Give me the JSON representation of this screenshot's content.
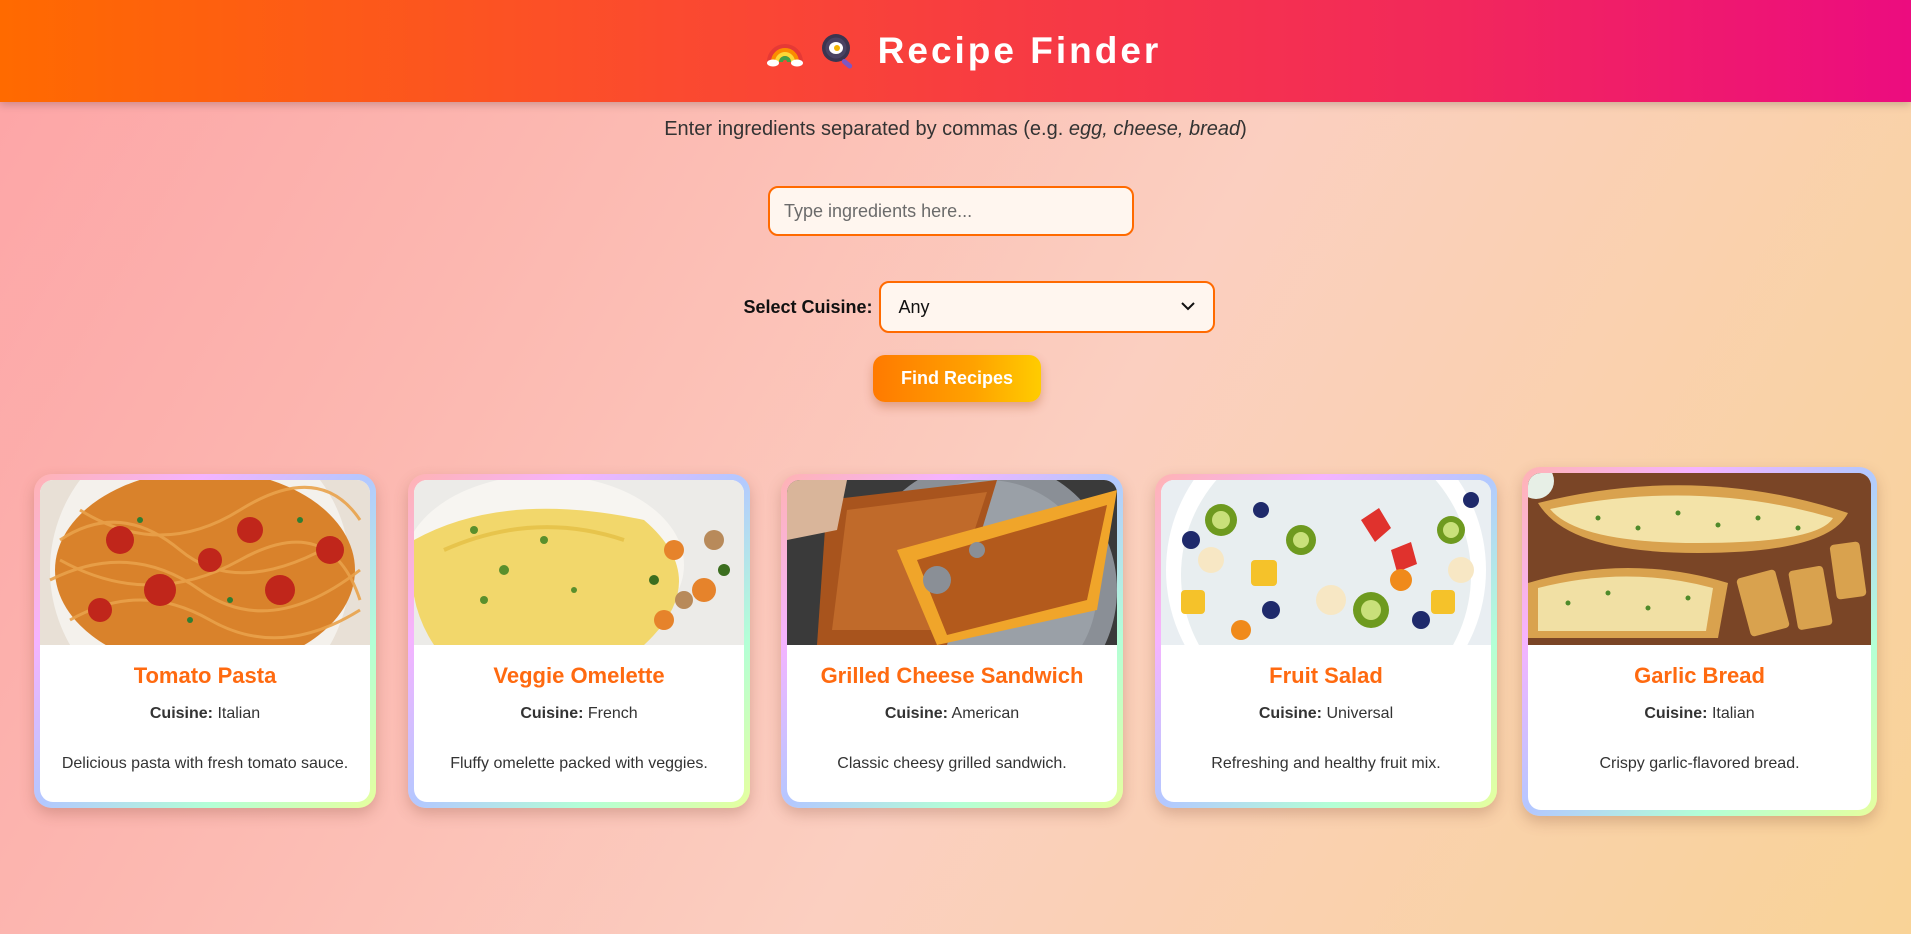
{
  "header": {
    "title": "Recipe Finder",
    "icons": [
      "rainbow-icon",
      "frying-pan-egg-icon"
    ]
  },
  "instructions": {
    "prefix": "Enter ingredients separated by commas (e.g. ",
    "example": "egg, cheese, bread",
    "suffix": ")"
  },
  "search": {
    "placeholder": "Type ingredients here...",
    "value": ""
  },
  "cuisine": {
    "label": "Select Cuisine:",
    "selected": "Any"
  },
  "find_button": {
    "label": "Find Recipes"
  },
  "cards": [
    {
      "title": "Tomato Pasta",
      "cuisine_label": "Cuisine:",
      "cuisine": "Italian",
      "description": "Delicious pasta with fresh tomato sauce.",
      "image": "spaghetti-with-tomatoes"
    },
    {
      "title": "Veggie Omelette",
      "cuisine_label": "Cuisine:",
      "cuisine": "French",
      "description": "Fluffy omelette packed with veggies.",
      "image": "omelette-with-vegetables"
    },
    {
      "title": "Grilled Cheese Sandwich",
      "cuisine_label": "Cuisine:",
      "cuisine": "American",
      "description": "Classic cheesy grilled sandwich.",
      "image": "grilled-cheese-sandwich"
    },
    {
      "title": "Fruit Salad",
      "cuisine_label": "Cuisine:",
      "cuisine": "Universal",
      "description": "Refreshing and healthy fruit mix.",
      "image": "fruit-salad-bowl"
    },
    {
      "title": "Garlic Bread",
      "cuisine_label": "Cuisine:",
      "cuisine": "Italian",
      "description": "Crispy garlic-flavored bread.",
      "image": "garlic-bread-on-board"
    }
  ],
  "colors": {
    "accent": "#ff6a00",
    "card_title": "#ff6a10",
    "header_start": "#ff6a00",
    "header_end": "#ec0c7f"
  }
}
